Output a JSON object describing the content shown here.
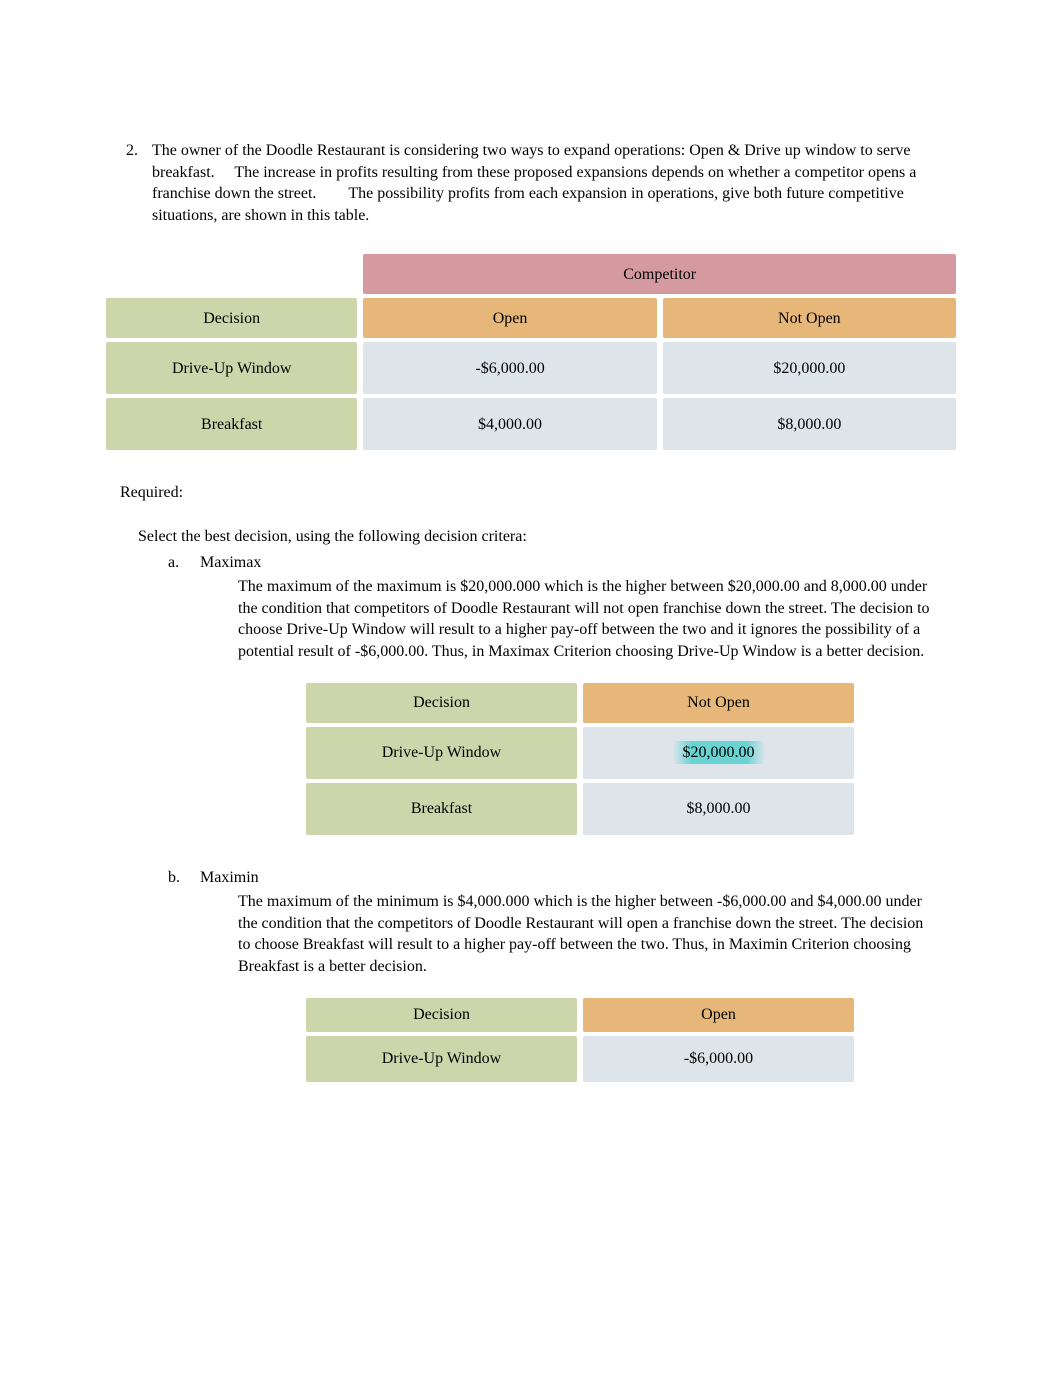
{
  "question": {
    "number": "2.",
    "text": "The owner of the Doodle Restaurant is considering two ways to expand operations: Open & Drive up window to serve breakfast.  The increase in profits resulting from these proposed expansions depends on whether a competitor opens a franchise down the street.  The possibility profits from each expansion in operations, give both future competitive situations, are shown in this table."
  },
  "main_table": {
    "group_header": "Competitor",
    "row_header_title": "Decision",
    "col_headers": [
      "Open",
      "Not Open"
    ],
    "rows": [
      {
        "label": "Drive-Up Window",
        "values": [
          "-$6,000.00",
          "$20,000.00"
        ]
      },
      {
        "label": "Breakfast",
        "values": [
          "$4,000.00",
          "$8,000.00"
        ]
      }
    ]
  },
  "required_label": "Required:",
  "lead_line": "Select the best decision, using the following decision critera:",
  "parts": {
    "a": {
      "letter": "a.",
      "title": "Maximax",
      "text": "The maximum of the maximum is $20,000.000 which is the higher between $20,000.00 and 8,000.00 under the condition that competitors of Doodle Restaurant will not open franchise down the street. The decision to choose Drive-Up Window will result to a higher pay-off between the two and it ignores the possibility of a potential result of -$6,000.00. Thus, in Maximax Criterion choosing Drive-Up Window is a better decision.",
      "table": {
        "row_header_title": "Decision",
        "col_header": "Not Open",
        "rows": [
          {
            "label": "Drive-Up Window",
            "value": "$20,000.00",
            "highlight": true
          },
          {
            "label": "Breakfast",
            "value": "$8,000.00",
            "highlight": false
          }
        ]
      }
    },
    "b": {
      "letter": "b.",
      "title": "Maximin",
      "text": "The maximum of the minimum is $4,000.000 which is the higher between -$6,000.00 and $4,000.00 under the condition that the competitors of Doodle Restaurant will open a franchise down the street. The decision to choose Breakfast will result to a higher pay-off between the two. Thus, in Maximin Criterion choosing Breakfast is a better decision.",
      "table": {
        "row_header_title": "Decision",
        "col_header": "Open",
        "rows": [
          {
            "label": "Drive-Up Window",
            "value": "-$6,000.00"
          }
        ]
      }
    }
  }
}
